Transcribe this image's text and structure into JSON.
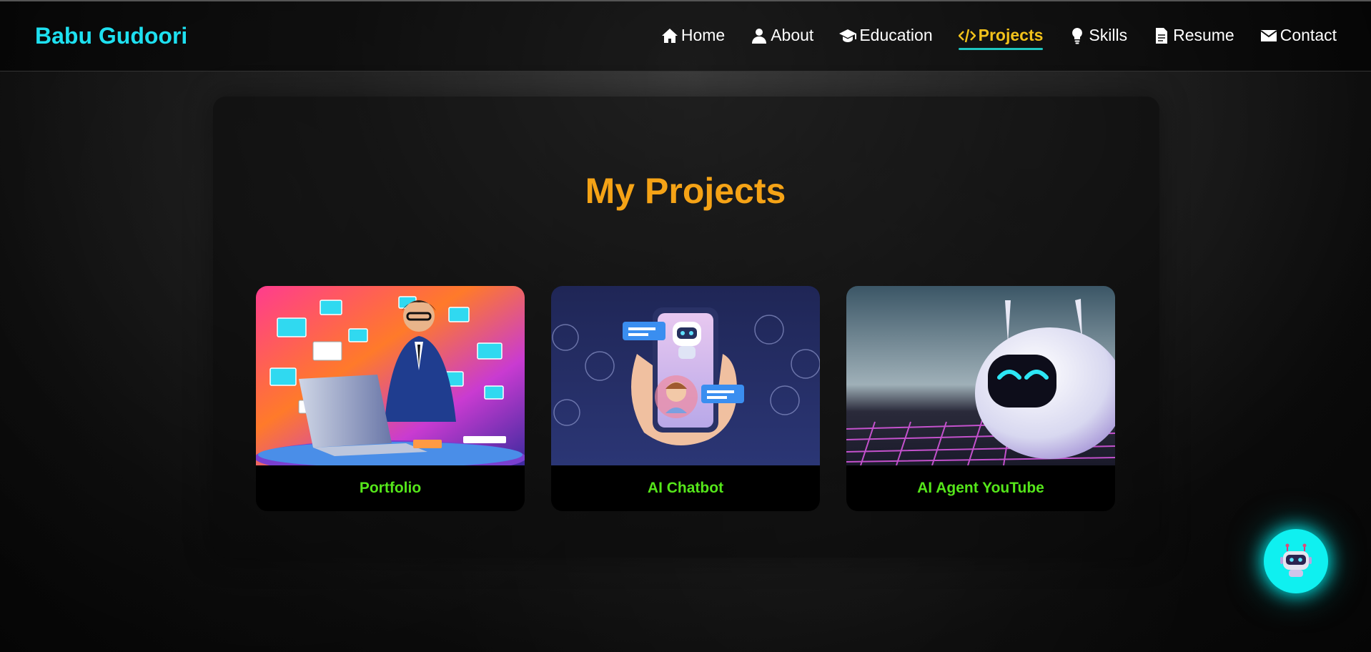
{
  "brand": "Babu Gudoori",
  "nav": [
    {
      "label": "Home",
      "icon": "home-icon"
    },
    {
      "label": "About",
      "icon": "user-icon"
    },
    {
      "label": "Education",
      "icon": "graduation-cap-icon"
    },
    {
      "label": "Projects",
      "icon": "code-icon",
      "active": true
    },
    {
      "label": "Skills",
      "icon": "lightbulb-icon"
    },
    {
      "label": "Resume",
      "icon": "document-icon"
    },
    {
      "label": "Contact",
      "icon": "envelope-icon"
    }
  ],
  "section_title": "My Projects",
  "projects": [
    {
      "title": "Portfolio",
      "image": "man-at-laptop-with-emails-illustration"
    },
    {
      "title": "AI Chatbot",
      "image": "phone-chatbot-illustration"
    },
    {
      "title": "AI Agent YouTube",
      "image": "white-robot-illustration"
    }
  ],
  "chat_button": {
    "icon": "robot-icon"
  },
  "colors": {
    "brand": "#1ee0f0",
    "active_nav": "#f2c21b",
    "title": "#f5a316",
    "card_label": "#55e61a",
    "chat_glow": "#00f5f5"
  }
}
